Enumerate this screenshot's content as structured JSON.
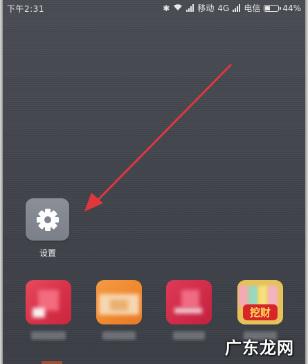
{
  "status_bar": {
    "time": "下午2:31",
    "carrier1": "移动",
    "network": "4G",
    "carrier2": "电信",
    "battery_percent": "44%",
    "battery_level": 0.44,
    "icons": [
      "bluetooth-icon",
      "wifi-icon",
      "signal-icon",
      "battery-icon"
    ]
  },
  "home": {
    "settings_app": {
      "label": "设置",
      "icon": "gear-icon"
    },
    "app4_badge_text": "挖财"
  },
  "annotation": {
    "arrow_color": "#e0373f"
  },
  "watermark": {
    "text": "广东龙网"
  },
  "colors": {
    "wallpaper": "#41444b",
    "settings_tile": "#80858e",
    "arrow": "#e0373f"
  }
}
